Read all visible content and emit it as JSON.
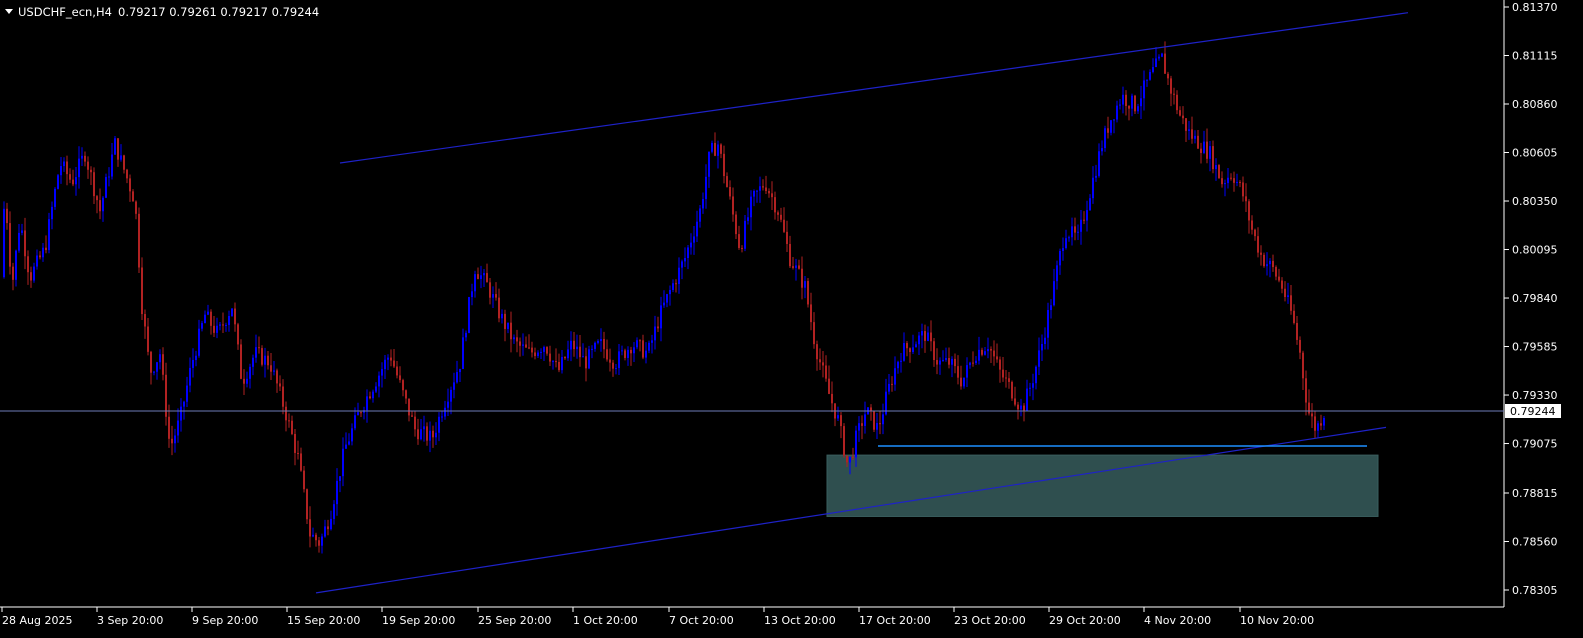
{
  "header": {
    "symbol": "USDCHF_ecn,H4",
    "ohlc": "0.79217 0.79261 0.79217 0.79244",
    "dropdown_icon": "triangle-down-icon"
  },
  "colors": {
    "background": "#000000",
    "bull_candle": "#0000ff",
    "bear_candle": "#b22222",
    "trendline": "#1e22c8",
    "grid_axis": "#ffffff",
    "price_line": "#6e7db8",
    "zone_fill": "#2f4f4f",
    "level_line": "#1e90ff"
  },
  "chart_data": {
    "type": "candlestick",
    "symbol": "USDCHF_ecn",
    "timeframe": "H4",
    "last_price": "0.79244",
    "ylim": [
      0.7818,
      0.8138
    ],
    "y_ticks": [
      "0.81370",
      "0.81115",
      "0.80860",
      "0.80605",
      "0.80350",
      "0.80095",
      "0.79840",
      "0.79585",
      "0.79330",
      "0.79075",
      "0.78815",
      "0.78560",
      "0.78305"
    ],
    "x_ticks": [
      "28 Aug 2025",
      "3 Sep 20:00",
      "9 Sep 20:00",
      "15 Sep 20:00",
      "19 Sep 20:00",
      "25 Sep 20:00",
      "1 Oct 20:00",
      "7 Oct 20:00",
      "13 Oct 20:00",
      "17 Oct 20:00",
      "23 Oct 20:00",
      "29 Oct 20:00",
      "4 Nov 20:00",
      "10 Nov 20:00"
    ],
    "price_path": [
      [
        0,
        0.7995
      ],
      [
        5,
        0.804
      ],
      [
        12,
        0.799
      ],
      [
        20,
        0.8025
      ],
      [
        30,
        0.7995
      ],
      [
        45,
        0.801
      ],
      [
        60,
        0.8055
      ],
      [
        72,
        0.8045
      ],
      [
        85,
        0.806
      ],
      [
        100,
        0.803
      ],
      [
        115,
        0.8065
      ],
      [
        125,
        0.805
      ],
      [
        135,
        0.8035
      ],
      [
        142,
        0.798
      ],
      [
        150,
        0.7945
      ],
      [
        160,
        0.7955
      ],
      [
        170,
        0.7905
      ],
      [
        180,
        0.792
      ],
      [
        192,
        0.795
      ],
      [
        205,
        0.7975
      ],
      [
        218,
        0.7965
      ],
      [
        232,
        0.798
      ],
      [
        242,
        0.794
      ],
      [
        255,
        0.7955
      ],
      [
        270,
        0.795
      ],
      [
        285,
        0.7925
      ],
      [
        298,
        0.79
      ],
      [
        310,
        0.786
      ],
      [
        320,
        0.7855
      ],
      [
        330,
        0.787
      ],
      [
        345,
        0.7905
      ],
      [
        360,
        0.7925
      ],
      [
        375,
        0.794
      ],
      [
        390,
        0.7955
      ],
      [
        402,
        0.7935
      ],
      [
        415,
        0.7915
      ],
      [
        432,
        0.791
      ],
      [
        445,
        0.793
      ],
      [
        460,
        0.795
      ],
      [
        475,
        0.8
      ],
      [
        488,
        0.799
      ],
      [
        500,
        0.7975
      ],
      [
        515,
        0.796
      ],
      [
        530,
        0.7955
      ],
      [
        545,
        0.796
      ],
      [
        558,
        0.7945
      ],
      [
        572,
        0.796
      ],
      [
        585,
        0.795
      ],
      [
        600,
        0.796
      ],
      [
        615,
        0.795
      ],
      [
        632,
        0.796
      ],
      [
        648,
        0.7955
      ],
      [
        660,
        0.7975
      ],
      [
        672,
        0.799
      ],
      [
        685,
        0.8005
      ],
      [
        700,
        0.803
      ],
      [
        710,
        0.806
      ],
      [
        718,
        0.8065
      ],
      [
        728,
        0.804
      ],
      [
        740,
        0.801
      ],
      [
        752,
        0.8035
      ],
      [
        765,
        0.8045
      ],
      [
        778,
        0.803
      ],
      [
        790,
        0.8005
      ],
      [
        805,
        0.799
      ],
      [
        815,
        0.796
      ],
      [
        828,
        0.7935
      ],
      [
        838,
        0.792
      ],
      [
        848,
        0.7895
      ],
      [
        856,
        0.791
      ],
      [
        866,
        0.7925
      ],
      [
        878,
        0.7915
      ],
      [
        888,
        0.7935
      ],
      [
        900,
        0.7955
      ],
      [
        912,
        0.796
      ],
      [
        925,
        0.7965
      ],
      [
        938,
        0.795
      ],
      [
        950,
        0.795
      ],
      [
        962,
        0.794
      ],
      [
        975,
        0.7955
      ],
      [
        988,
        0.796
      ],
      [
        1000,
        0.7945
      ],
      [
        1012,
        0.7935
      ],
      [
        1022,
        0.7925
      ],
      [
        1032,
        0.794
      ],
      [
        1042,
        0.796
      ],
      [
        1052,
        0.7985
      ],
      [
        1065,
        0.802
      ],
      [
        1078,
        0.8015
      ],
      [
        1090,
        0.804
      ],
      [
        1102,
        0.8065
      ],
      [
        1112,
        0.808
      ],
      [
        1122,
        0.809
      ],
      [
        1135,
        0.8085
      ],
      [
        1145,
        0.8095
      ],
      [
        1155,
        0.8105
      ],
      [
        1162,
        0.811
      ],
      [
        1170,
        0.8095
      ],
      [
        1180,
        0.808
      ],
      [
        1190,
        0.807
      ],
      [
        1200,
        0.8065
      ],
      [
        1210,
        0.806
      ],
      [
        1222,
        0.8045
      ],
      [
        1232,
        0.805
      ],
      [
        1242,
        0.804
      ],
      [
        1252,
        0.802
      ],
      [
        1262,
        0.8005
      ],
      [
        1272,
        0.8
      ],
      [
        1282,
        0.799
      ],
      [
        1292,
        0.7975
      ],
      [
        1300,
        0.7955
      ],
      [
        1308,
        0.7925
      ],
      [
        1316,
        0.7915
      ],
      [
        1324,
        0.7924
      ]
    ],
    "trendline_upper": {
      "from": [
        340,
        0.8055
      ],
      "to": [
        1408,
        0.8134
      ]
    },
    "trendline_lower": {
      "from": [
        316,
        0.7829
      ],
      "to": [
        1386,
        0.7916
      ]
    },
    "demand_zone": {
      "x_from": 827,
      "x_to": 1378,
      "price_top": 0.7903,
      "price_bottom": 0.7876
    },
    "zone_top_line": {
      "x_from": 878,
      "x_to": 1367,
      "price": 0.7904
    }
  }
}
